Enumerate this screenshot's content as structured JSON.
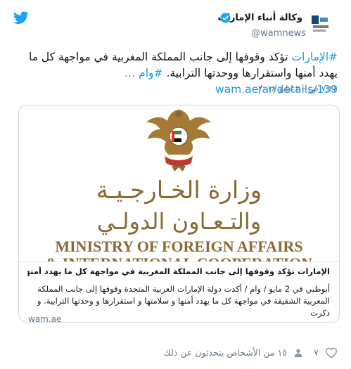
{
  "author": {
    "display_name": "وكالة أنباء الإمارات",
    "screen_name": "@wamnews",
    "verified": true
  },
  "tweet": {
    "hashtag": "#الإمارات",
    "text_main": " تؤكد وقوفها إلى جانب المملكة المغربية في مواجهة كل ما يهدد أمنها واستقرارها ووحدتها الترابية. ",
    "hashtag2": "#وام",
    "link": "…wam.ae/ar/details/139",
    "timestamp": "٧:٤٤ ص - ٢ مايو ٢٠١٨"
  },
  "card": {
    "image_text": {
      "arabic_line1": "وزارة الخـارجـيـة",
      "arabic_line2": "والتـعـاون الدولـي",
      "english_line1": "MINISTRY OF FOREIGN AFFAIRS",
      "english_line2": "& INTERNATIONAL COOPERATION"
    },
    "title": "الإمارات تؤكد وقوفها إلى جانب المملكة المغربية في مواجهة كل ما يهدد أمنها واستقرارها و...",
    "description": "أبوظبي في 2 مايو / وام / أكدت دولة الإمارات العربية المتحدة وقوفها إلى جانب المملكة المغربية الشقيقة في مواجهة كل ما يهدد أمنها و سلامتها و استقرارها و وحدتها الترابية. و ذكرت",
    "domain": "wam.ae"
  },
  "footer": {
    "like_count": "٧",
    "people_count_text": "١٥ من الأشخاص يتحدثون عن ذلك"
  },
  "colors": {
    "link": "#1b95e0",
    "twitter_blue": "#1da1f2",
    "muted": "#657786",
    "gold": "#8a6a34"
  },
  "icons": [
    "twitter-bird-icon",
    "verified-badge-icon",
    "heart-icon",
    "people-icon"
  ]
}
